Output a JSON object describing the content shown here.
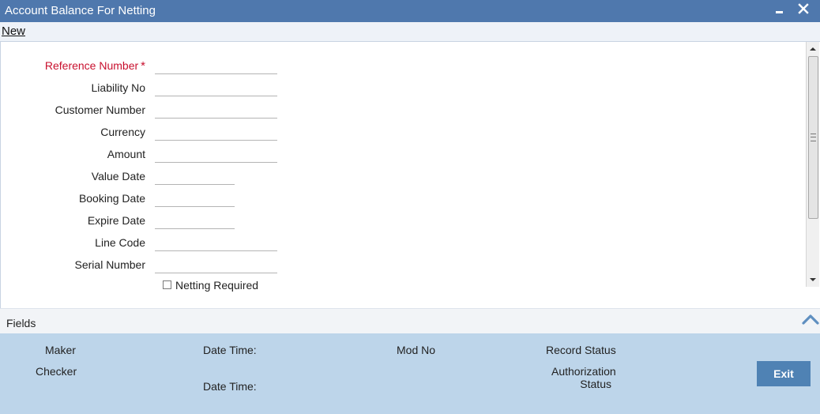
{
  "window": {
    "title": "Account Balance For Netting"
  },
  "menu": {
    "new_label": "New"
  },
  "form": {
    "fields": [
      {
        "label": "Reference Number",
        "required": true,
        "value": ""
      },
      {
        "label": "Liability No",
        "value": ""
      },
      {
        "label": "Customer Number",
        "value": ""
      },
      {
        "label": "Currency",
        "value": ""
      },
      {
        "label": "Amount",
        "value": ""
      },
      {
        "label": "Value Date",
        "value": ""
      },
      {
        "label": "Booking Date",
        "value": ""
      },
      {
        "label": "Expire Date",
        "value": ""
      },
      {
        "label": "Line Code",
        "value": ""
      },
      {
        "label": "Serial Number",
        "value": ""
      }
    ],
    "netting_required_label": "Netting Required",
    "netting_required_checked": false
  },
  "fields_section": {
    "label": "Fields"
  },
  "audit": {
    "maker_label": "Maker",
    "checker_label": "Checker",
    "date_time_label": "Date Time:",
    "mod_no_label": "Mod No",
    "record_status_label": "Record Status",
    "authorization_status_label_1": "Authorization",
    "authorization_status_label_2": "Status",
    "exit_label": "Exit"
  },
  "colors": {
    "titlebar": "#4f78ad",
    "audit_panel": "#bdd5ea",
    "exit_button": "#4f82b4",
    "required": "#c8102e"
  }
}
